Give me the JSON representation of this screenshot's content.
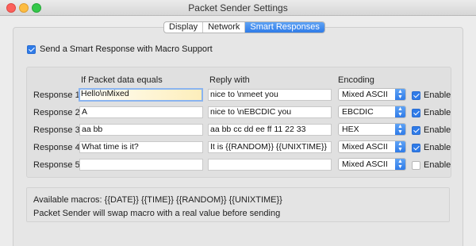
{
  "window": {
    "title": "Packet Sender Settings"
  },
  "tabs": [
    {
      "label": "Display",
      "active": false
    },
    {
      "label": "Network",
      "active": false
    },
    {
      "label": "Smart Responses",
      "active": true
    }
  ],
  "smart": {
    "label": "Send a Smart Response with Macro Support",
    "checked": true
  },
  "headers": {
    "if_packet": "If Packet data equals",
    "reply": "Reply with",
    "encoding": "Encoding"
  },
  "rows": [
    {
      "label": "Response 1",
      "match": "Hello\\nMixed",
      "reply": "nice to \\nmeet you",
      "encoding": "Mixed ASCII",
      "enable_label": "Enable",
      "enabled": true
    },
    {
      "label": "Response 2",
      "match": "A",
      "reply": "nice to \\nEBCDIC you",
      "encoding": "EBCDIC",
      "enable_label": "Enable",
      "enabled": true
    },
    {
      "label": "Response 3",
      "match": "aa bb",
      "reply": "aa bb cc dd ee ff 11 22 33",
      "encoding": "HEX",
      "enable_label": "Enable",
      "enabled": true
    },
    {
      "label": "Response 4",
      "match": "What time is it?",
      "reply": "It is {{RANDOM}} {{UNIXTIME}}",
      "encoding": "Mixed ASCII",
      "enable_label": "Enable",
      "enabled": true
    },
    {
      "label": "Response 5",
      "match": "",
      "reply": "",
      "encoding": "Mixed ASCII",
      "enable_label": "Enable",
      "enabled": false
    }
  ],
  "macros": {
    "line1": "Available macros: {{DATE}} {{TIME}} {{RANDOM}} {{UNIXTIME}}",
    "line2": "Packet Sender will swap macro with a real value before sending"
  },
  "colors": {
    "accent": "#2f7be8",
    "close": "#fc605b",
    "minimize": "#fdbc40",
    "maximize": "#34c84a"
  }
}
